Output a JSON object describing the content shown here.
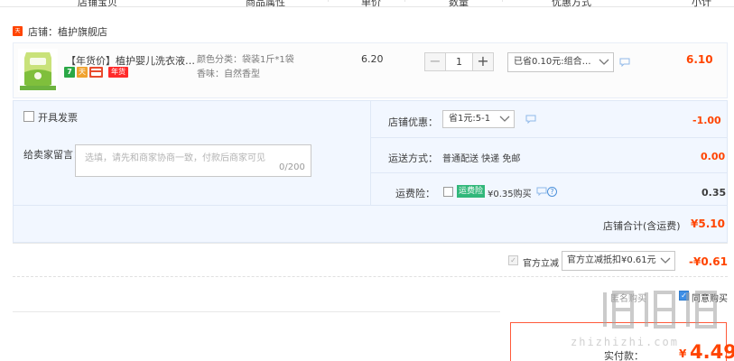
{
  "header": {
    "columns": [
      "店铺宝贝",
      "商品属性",
      "单价",
      "数量",
      "优惠方式",
      "小计"
    ]
  },
  "shop": {
    "tag": "天猫",
    "name": "店铺：植护旗舰店"
  },
  "item": {
    "title": "【年货价】植护婴儿洗衣液婴幼儿专用",
    "badges": [
      "7",
      "天",
      "",
      "年货"
    ],
    "sku_color": "颜色分类：袋装1斤*1袋",
    "sku_scent": "香味：自然香型",
    "price": "6.20",
    "qty_minus": "−",
    "qty": "1",
    "qty_plus": "+",
    "promo_option": "已省0.10元:组合…",
    "subtotal": "6.10"
  },
  "options": {
    "invoice_label": "开具发票",
    "message_label": "给卖家留言：",
    "message_placeholder": "选填，请先和商家协商一致，付款后商家可见",
    "message_count": "0/200",
    "coupon_label": "店铺优惠：",
    "coupon_option": "省1元:5-1",
    "coupon_amount": "-1.00",
    "shipping_label": "运送方式：",
    "shipping_value": "普通配送 快递 免邮",
    "shipping_amount": "0.00",
    "insurance_label": "运费险：",
    "insurance_tag": "运费险",
    "insurance_price": "¥0.35购买",
    "insurance_qmark": "?",
    "insurance_amount": "0.35",
    "shop_total_label": "店铺合计(含运费)",
    "shop_total_value": "¥5.10"
  },
  "discount": {
    "label": "官方立减",
    "option": "官方立减抵扣¥0.61元",
    "amount": "-¥0.61"
  },
  "footer": {
    "anonymous_label": "匿名购买",
    "agree_label": "同意购买",
    "pay_label": "实付款：",
    "pay_currency": "¥",
    "pay_amount": "4.49"
  },
  "watermark": {
    "text": "zhizhizhi.com"
  },
  "colors": {
    "accent": "#ff4400",
    "options_bg": "#f2f7ff",
    "insurance_green": "#31b77a",
    "checkbox_blue": "#3d8ee6"
  }
}
